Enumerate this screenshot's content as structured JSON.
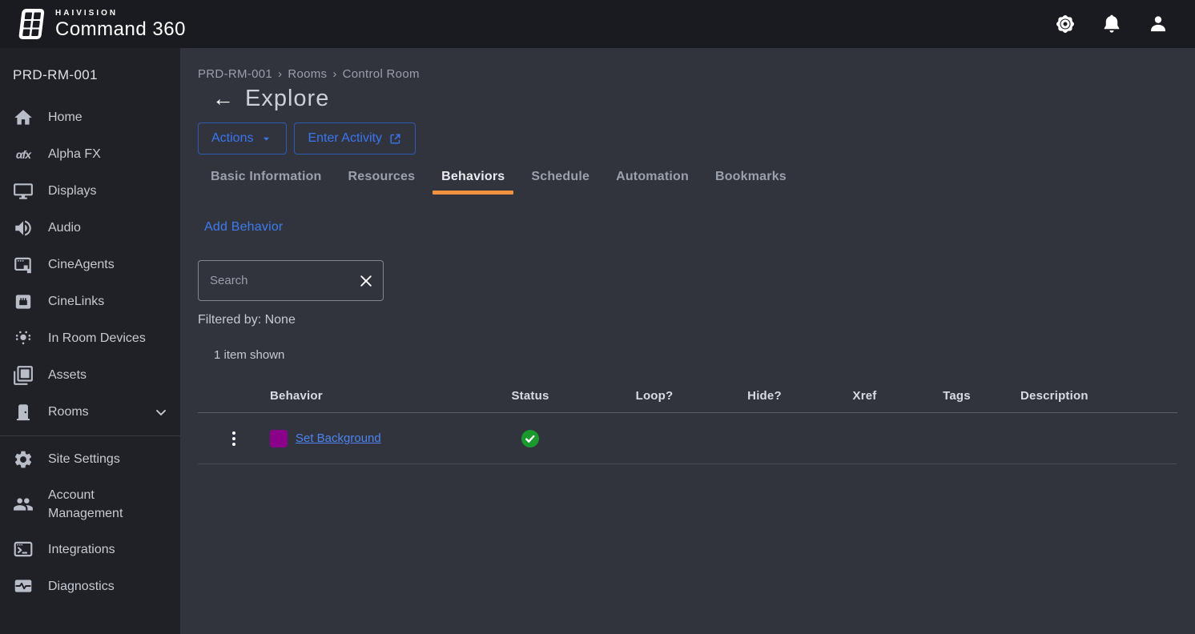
{
  "app": {
    "brand_top": "HAIVISION",
    "brand_bottom": "Command 360"
  },
  "topbar": {
    "icons": [
      {
        "name": "settings-gear-icon"
      },
      {
        "name": "notifications-bell-icon"
      },
      {
        "name": "account-person-icon"
      }
    ]
  },
  "sidebar": {
    "title": "PRD-RM-001",
    "items": [
      {
        "label": "Home",
        "icon": "home-icon"
      },
      {
        "label": "Alpha FX",
        "icon": "alpha-fx-icon"
      },
      {
        "label": "Displays",
        "icon": "display-icon"
      },
      {
        "label": "Audio",
        "icon": "audio-icon"
      },
      {
        "label": "CineAgents",
        "icon": "cineagents-icon"
      },
      {
        "label": "CineLinks",
        "icon": "cinelinks-icon"
      },
      {
        "label": "In Room Devices",
        "icon": "in-room-devices-icon"
      },
      {
        "label": "Assets",
        "icon": "assets-icon"
      },
      {
        "label": "Rooms",
        "icon": "rooms-door-icon",
        "expanded": false
      },
      {
        "label": "Site Settings",
        "icon": "site-settings-gear-icon"
      },
      {
        "label": "Account Management",
        "icon": "account-management-icon"
      },
      {
        "label": "Integrations",
        "icon": "integrations-terminal-icon"
      },
      {
        "label": "Diagnostics",
        "icon": "diagnostics-icon"
      }
    ]
  },
  "main": {
    "breadcrumb": {
      "part1": "PRD-RM-001",
      "part2": "Rooms",
      "part3": "Control Room",
      "separator": "›"
    },
    "title": "Explore",
    "back_arrow": "←",
    "buttons": {
      "actions_label": "Actions",
      "enter_activity_label": "Enter Activity"
    },
    "tabs": [
      {
        "label": "Basic Information",
        "active": false
      },
      {
        "label": "Resources",
        "active": false
      },
      {
        "label": "Behaviors",
        "active": true
      },
      {
        "label": "Schedule",
        "active": false
      },
      {
        "label": "Automation",
        "active": false
      },
      {
        "label": "Bookmarks",
        "active": false
      }
    ],
    "add_behavior_label": "Add Behavior",
    "search": {
      "placeholder": "Search"
    },
    "filtered_by": "Filtered by: None",
    "items_shown": "1 item shown",
    "table": {
      "columns": [
        "Behavior",
        "Status",
        "Loop?",
        "Hide?",
        "Xref",
        "Tags",
        "Description"
      ],
      "rows": [
        {
          "behavior": "Set Background",
          "color": "#8b008b",
          "status": "enabled",
          "loop": "",
          "hide": "",
          "xref": "",
          "tags": "",
          "description": ""
        }
      ]
    }
  },
  "colors": {
    "accent_orange": "#f0923f",
    "link_blue": "#3a75f2",
    "status_green": "#1a9a2e",
    "chip_magenta": "#8b008b",
    "topbar_bg": "#1a1b20",
    "sidebar_bg": "#1f2127",
    "content_bg": "#32343d"
  }
}
